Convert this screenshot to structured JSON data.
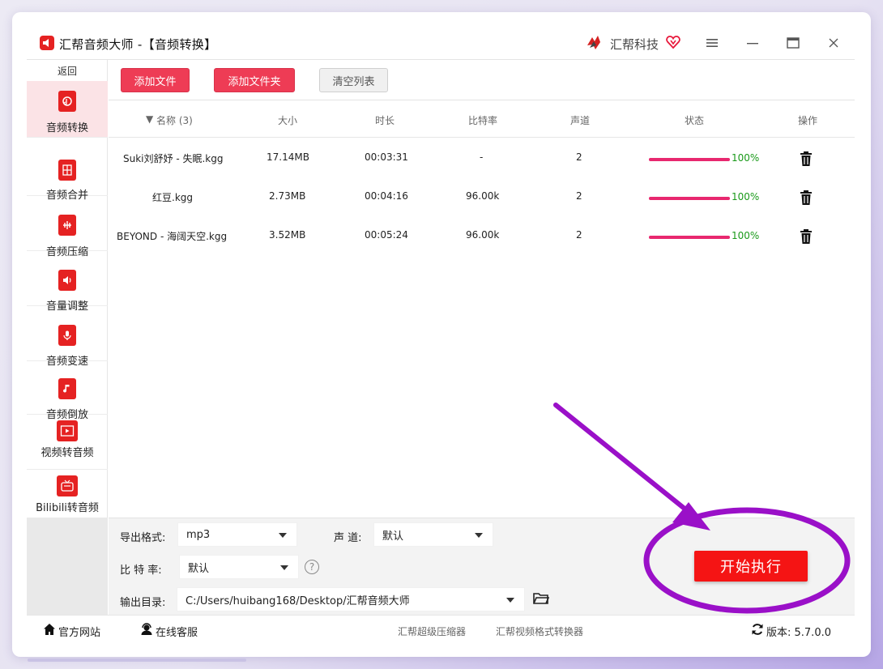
{
  "titlebar": {
    "app_title": "汇帮音频大师  -【音频转换】",
    "brand_name": "汇帮科技",
    "menu_icon": "hamburger-icon",
    "minimize_icon": "minimize-icon",
    "maximize_icon": "maximize-icon",
    "close_icon": "close-icon"
  },
  "sidebar": {
    "back_label": "返回",
    "items": [
      {
        "label": "音频转换",
        "icon": "audio-convert-icon",
        "active": true
      },
      {
        "label": "音频合并",
        "icon": "audio-merge-icon",
        "active": false
      },
      {
        "label": "音频压缩",
        "icon": "audio-compress-icon",
        "active": false
      },
      {
        "label": "音量调整",
        "icon": "volume-icon",
        "active": false
      },
      {
        "label": "音频变速",
        "icon": "microphone-icon",
        "active": false
      },
      {
        "label": "音频倒放",
        "icon": "music-note-icon",
        "active": false
      },
      {
        "label": "视频转音频",
        "icon": "video-icon",
        "active": false
      },
      {
        "label": "Bilibili转音频",
        "icon": "tv-icon",
        "active": false
      }
    ]
  },
  "toolbar": {
    "add_file": "添加文件",
    "add_folder": "添加文件夹",
    "clear_list": "清空列表"
  },
  "table": {
    "headers": {
      "name": "名称 (3)",
      "size": "大小",
      "duration": "时长",
      "bitrate": "比特率",
      "channels": "声道",
      "status": "状态",
      "action": "操作"
    },
    "rows": [
      {
        "name": "Suki刘舒妤 - 失眠.kgg",
        "size": "17.14MB",
        "duration": "00:03:31",
        "bitrate": "-",
        "channels": "2",
        "progress": 1.0,
        "progress_label": "100%"
      },
      {
        "name": "红豆.kgg",
        "size": "2.73MB",
        "duration": "00:04:16",
        "bitrate": "96.00k",
        "channels": "2",
        "progress": 1.0,
        "progress_label": "100%"
      },
      {
        "name": "BEYOND - 海阔天空.kgg",
        "size": "3.52MB",
        "duration": "00:05:24",
        "bitrate": "96.00k",
        "channels": "2",
        "progress": 1.0,
        "progress_label": "100%"
      }
    ]
  },
  "settings": {
    "format_label": "导出格式:",
    "format_value": "mp3",
    "channel_label": "声 道:",
    "channel_value": "默认",
    "bitrate_label": "比 特 率:",
    "bitrate_value": "默认",
    "help_glyph": "?",
    "output_label": "输出目录:",
    "output_value": "C:/Users/huibang168/Desktop/汇帮音频大师",
    "start_button": "开始执行"
  },
  "footer": {
    "website": "官方网站",
    "support": "在线客服",
    "link1": "汇帮超级压缩器",
    "link2": "汇帮视频格式转换器",
    "version": "版本: 5.7.0.0"
  },
  "colors": {
    "accent_red": "#ee3c55",
    "start_red": "#f51414",
    "progress": "#e8286f",
    "annotation_purple": "#9a10c8"
  }
}
